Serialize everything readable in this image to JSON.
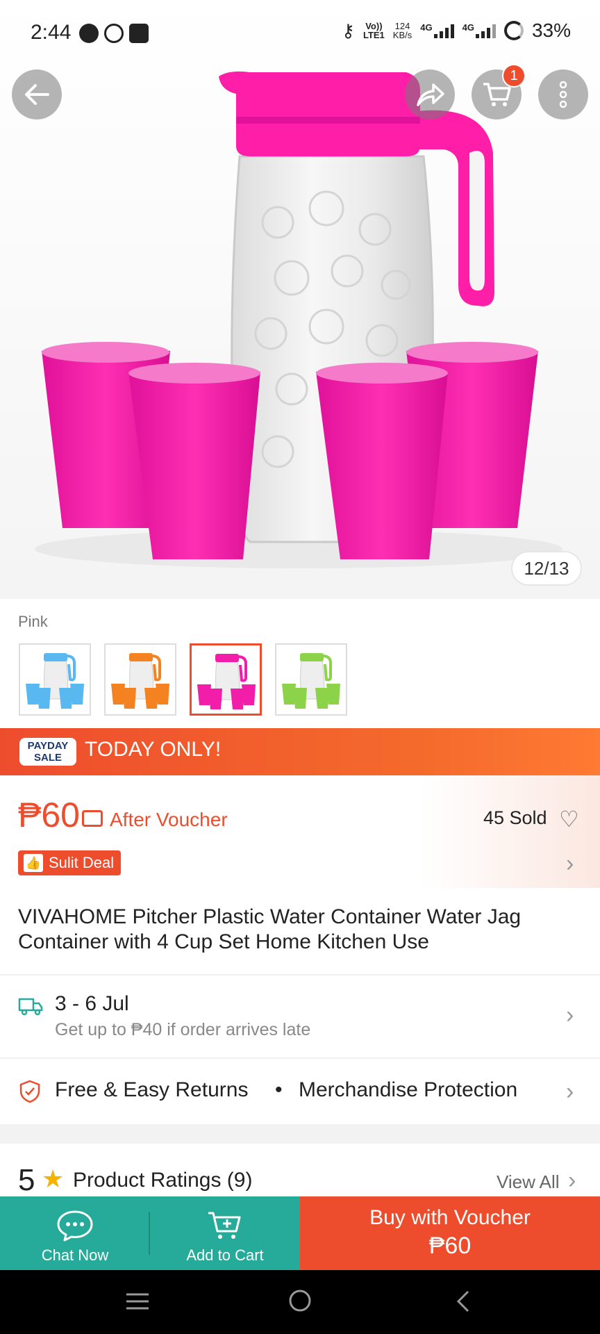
{
  "status_bar": {
    "time": "2:44",
    "net_volte_top": "Vo))",
    "net_volte_bottom": "LTE1",
    "speed_value": "124",
    "speed_unit": "KB/s",
    "sig1": "4G",
    "sig2": "4G",
    "battery": "33%"
  },
  "header": {
    "back_icon": "arrow-left-icon",
    "share_icon": "share-icon",
    "cart_icon": "cart-icon",
    "cart_badge": "1",
    "more_icon": "more-vertical-icon"
  },
  "gallery": {
    "counter": "12/13",
    "product_color": "#ff1ea8"
  },
  "variations": {
    "selected_label": "Pink",
    "options": [
      {
        "color": "#5ab8f0"
      },
      {
        "color": "#f58220"
      },
      {
        "color": "#f21da8"
      },
      {
        "color": "#8dd34a"
      }
    ]
  },
  "promo_banner": {
    "logo_line1": "PAYDAY",
    "logo_line2": "SALE",
    "text": "TODAY ONLY!"
  },
  "price_block": {
    "price": "₱60",
    "after_voucher": "After Voucher",
    "sold": "45 Sold",
    "deal_label": "Sulit Deal"
  },
  "product": {
    "title": "VIVAHOME Pitcher Plastic Water Container Water Jag Container with 4 Cup Set Home Kitchen Use"
  },
  "shipping": {
    "dates": "3 - 6 Jul",
    "guarantee": "Get up to ₱40 if order arrives late"
  },
  "protection": {
    "returns": "Free & Easy Returns",
    "bullet": "•",
    "protection": "Merchandise Protection"
  },
  "ratings": {
    "score": "5",
    "label": "Product Ratings (9)",
    "view_all": "View All"
  },
  "action_bar": {
    "chat_label": "Chat Now",
    "cart_label": "Add to Cart",
    "buy_line1": "Buy with Voucher",
    "buy_line2": "₱60"
  },
  "colors": {
    "brand": "#ee4d2d",
    "teal": "#26aa99"
  }
}
